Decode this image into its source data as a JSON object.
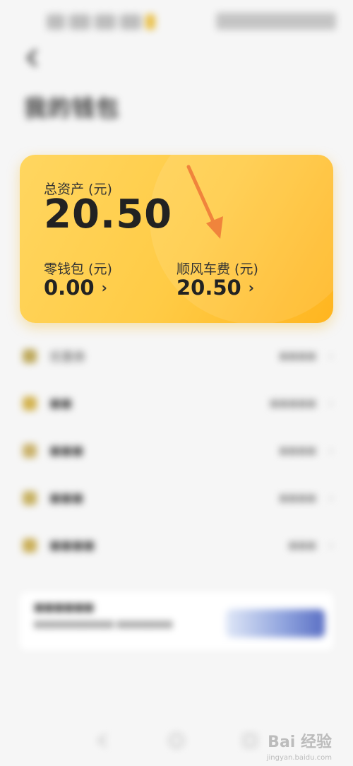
{
  "header": {
    "title": "我的钱包"
  },
  "card": {
    "total_label": "总资产 (元)",
    "total_value": "20.50",
    "wallet_label": "零钱包 (元)",
    "wallet_value": "0.00",
    "ride_fee_label": "顺风车费 (元)",
    "ride_fee_value": "20.50",
    "chevron": "›"
  },
  "list": {
    "items": [
      {
        "label": "优惠券",
        "value": "",
        "icon": "coupon-icon"
      },
      {
        "label": "",
        "value": "",
        "icon": "wallet-icon"
      },
      {
        "label": "",
        "value": "",
        "icon": "card-icon"
      },
      {
        "label": "",
        "value": "",
        "icon": "gift-icon"
      },
      {
        "label": "",
        "value": "",
        "icon": "service-icon"
      }
    ],
    "chevron": "›"
  },
  "banner": {
    "title": "",
    "subtitle": ""
  },
  "watermark": {
    "text": "Bai 经验",
    "sub": "jingyan.baidu.com"
  },
  "colors": {
    "card_start": "#ffd660",
    "card_end": "#ffb51f",
    "annotation_arrow": "#f0843c"
  }
}
